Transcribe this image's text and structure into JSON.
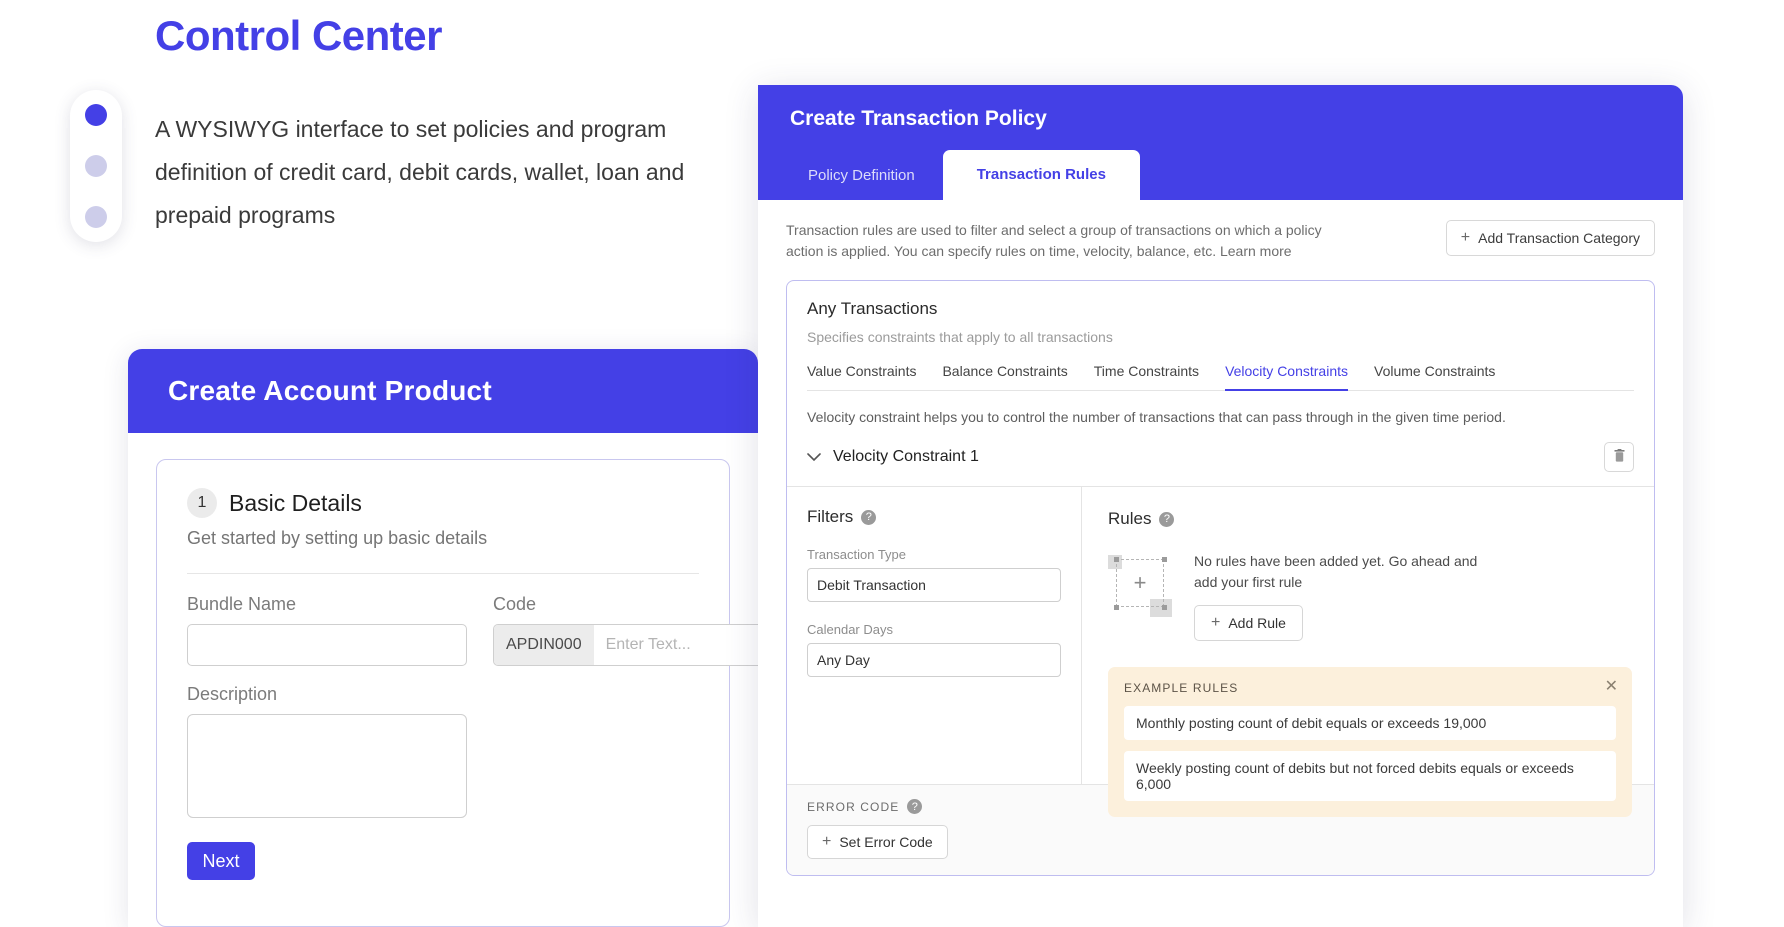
{
  "hero": {
    "title": "Control Center",
    "description": "A WYSIWYG interface to set policies and program definition of credit card, debit cards, wallet, loan and prepaid programs",
    "dots": [
      {
        "name": "dot-1",
        "active": true
      },
      {
        "name": "dot-2",
        "active": false
      },
      {
        "name": "dot-3",
        "active": false
      }
    ]
  },
  "account_product_card": {
    "header_title": "Create Account Product",
    "step": {
      "number": "1",
      "title": "Basic Details",
      "subtitle": "Get started by setting up basic details"
    },
    "fields": {
      "bundle_name_label": "Bundle Name",
      "bundle_name_value": "",
      "bundle_name_placeholder": "",
      "code_label": "Code",
      "code_prefix": "APDIN000",
      "code_placeholder": "Enter Text...",
      "description_label": "Description",
      "description_value": ""
    },
    "next_label": "Next"
  },
  "policy_panel": {
    "header_title": "Create Transaction Policy",
    "tabs": [
      {
        "label": "Policy Definition",
        "active": false
      },
      {
        "label": "Transaction Rules",
        "active": true
      }
    ],
    "description": "Transaction rules are used to filter and select a group of transactions on which a policy action is applied. You can specify rules on time, velocity, balance, etc. Learn more",
    "add_category_label": "Add Transaction Category",
    "add_icon": "plus-icon",
    "transaction_card": {
      "title": "Any Transactions",
      "subtitle": "Specifies constraints that apply to all transactions",
      "constraint_tabs": [
        {
          "label": "Value Constraints",
          "active": false
        },
        {
          "label": "Balance Constraints",
          "active": false
        },
        {
          "label": "Time Constraints",
          "active": false
        },
        {
          "label": "Velocity Constraints",
          "active": true
        },
        {
          "label": "Volume Constraints",
          "active": false
        }
      ],
      "velocity_description": "Velocity constraint helps you to control the number of transactions that can pass through in the given time period.",
      "constraint": {
        "name": "Velocity Constraint 1",
        "chevron": "chevron-down-icon",
        "delete_icon": "trash-icon"
      },
      "filters": {
        "title": "Filters",
        "help_icon": "help-icon",
        "items": [
          {
            "label": "Transaction Type",
            "value": "Debit Transaction"
          },
          {
            "label": "Calendar Days",
            "value": "Any Day"
          }
        ]
      },
      "rules": {
        "title": "Rules",
        "help_icon": "help-icon",
        "empty_message": "No rules have been added yet. Go ahead and add your first rule",
        "add_rule_label": "Add Rule",
        "empty_art_icon": "add-placeholder-icon",
        "examples": {
          "title": "EXAMPLE RULES",
          "close_icon": "close-icon",
          "items": [
            "Monthly posting count of debit equals or exceeds 19,000",
            "Weekly posting count of debits but not forced debits equals or exceeds 6,000"
          ]
        }
      },
      "error_code": {
        "title": "ERROR CODE",
        "help_icon": "help-icon",
        "button_label": "Set Error Code"
      }
    }
  },
  "colors": {
    "brand_purple": "#4440e6",
    "example_bg": "#fcf0dc",
    "muted_text": "#9b9b9b"
  }
}
